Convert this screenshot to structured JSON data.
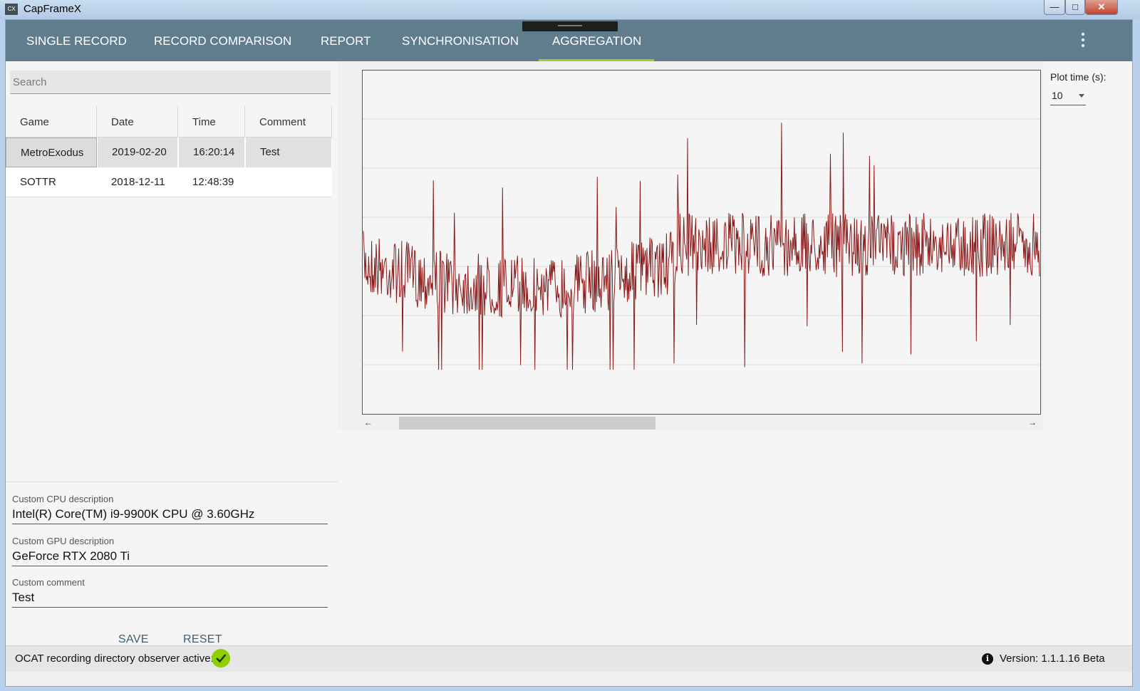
{
  "window": {
    "title": "CapFrameX",
    "icon_text": "CX"
  },
  "nav": {
    "tabs": [
      {
        "label": "SINGLE RECORD"
      },
      {
        "label": "RECORD COMPARISON"
      },
      {
        "label": "REPORT"
      },
      {
        "label": "SYNCHRONISATION"
      },
      {
        "label": "AGGREGATION"
      }
    ],
    "active_tab": "AGGREGATION",
    "accent_color": "#9ccc25",
    "bar_color": "#5f7d8d"
  },
  "search": {
    "placeholder": "Search",
    "value": ""
  },
  "records": {
    "columns": [
      "Game",
      "Date",
      "Time",
      "Comment"
    ],
    "rows": [
      {
        "game": "MetroExodus",
        "date": "2019-02-20",
        "time": "16:20:14",
        "comment": "Test",
        "selected": true
      },
      {
        "game": "SOTTR",
        "date": "2018-12-11",
        "time": "12:48:39",
        "comment": "",
        "selected": false
      }
    ]
  },
  "description": {
    "cpu_label": "Custom CPU description",
    "cpu_value": "Intel(R) Core(TM) i9-9900K CPU @ 3.60GHz",
    "gpu_label": "Custom GPU description",
    "gpu_value": "GeForce RTX 2080 Ti",
    "comment_label": "Custom comment",
    "comment_value": "Test",
    "save_label": "SAVE",
    "reset_label": "RESET"
  },
  "plot_time": {
    "label": "Plot time (s):",
    "value": "10"
  },
  "chart_data": {
    "type": "line",
    "series": [
      {
        "color": "#8b1a1a"
      }
    ],
    "grid": true
  },
  "status": {
    "observer_text": "OCAT recording directory observer active:",
    "version_text": "Version:  1.1.1.16 Beta",
    "ok_color": "#8fce00"
  }
}
